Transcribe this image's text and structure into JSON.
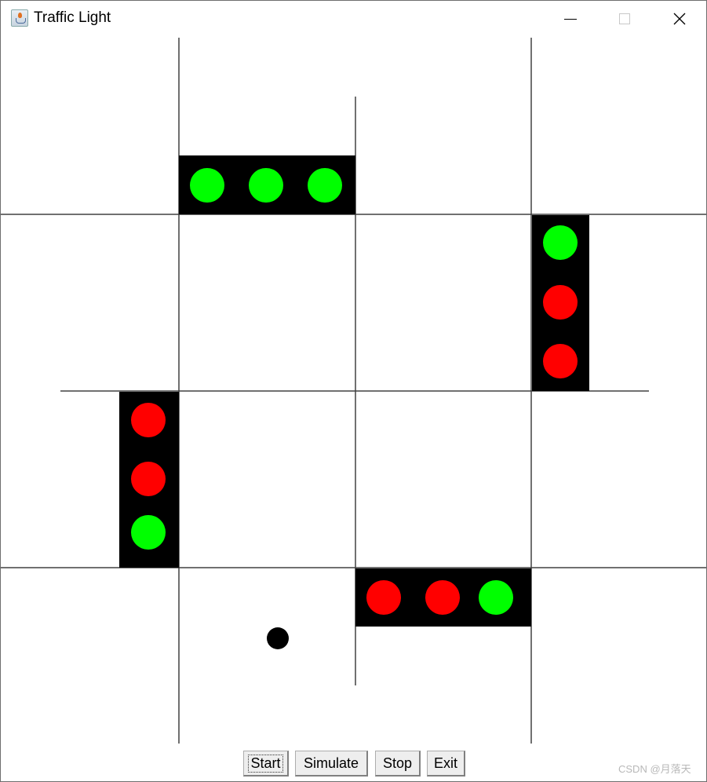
{
  "window": {
    "title": "Traffic Light",
    "controls": {
      "minimize": "minimize-icon",
      "maximize": "maximize-icon",
      "close": "close-icon"
    }
  },
  "colors": {
    "red": "#ff0000",
    "green": "#00ff00",
    "housing": "#000000",
    "line": "#404040",
    "car": "#000000"
  },
  "traffic_lights": [
    {
      "name": "north",
      "orientation": "horizontal",
      "lamps": [
        "green",
        "green",
        "green"
      ]
    },
    {
      "name": "east",
      "orientation": "vertical",
      "lamps": [
        "green",
        "red",
        "red"
      ]
    },
    {
      "name": "west",
      "orientation": "vertical",
      "lamps": [
        "red",
        "red",
        "green"
      ]
    },
    {
      "name": "south",
      "orientation": "horizontal",
      "lamps": [
        "red",
        "red",
        "green"
      ]
    }
  ],
  "car": {
    "label": "car"
  },
  "toolbar": {
    "start_label": "Start",
    "simulate_label": "Simulate",
    "stop_label": "Stop",
    "exit_label": "Exit"
  },
  "watermark": "CSDN @月落天"
}
